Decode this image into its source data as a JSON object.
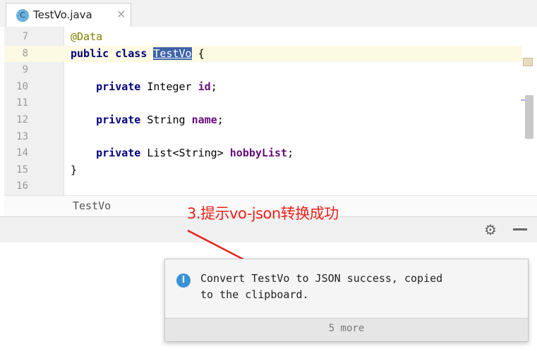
{
  "tab": {
    "icon_letter": "C",
    "label": "TestVo.java",
    "close": "×"
  },
  "editor": {
    "lines": [
      {
        "num": "7",
        "text": "@Data"
      },
      {
        "num": "8",
        "text": "public class TestVo {"
      },
      {
        "num": "9",
        "text": ""
      },
      {
        "num": "10",
        "text": "    private Integer id;"
      },
      {
        "num": "11",
        "text": ""
      },
      {
        "num": "12",
        "text": "    private String name;"
      },
      {
        "num": "13",
        "text": ""
      },
      {
        "num": "14",
        "text": "    private List<String> hobbyList;"
      },
      {
        "num": "15",
        "text": "}"
      },
      {
        "num": "16",
        "text": ""
      }
    ]
  },
  "breadcrumb": {
    "label": "TestVo"
  },
  "toolbar": {
    "gear_icon": "gear-icon",
    "minimize_icon": "minimize-icon"
  },
  "annotation": {
    "text": "3.提示vo-json转换成功",
    "color": "#e8221b"
  },
  "notification": {
    "icon": "info-icon",
    "line1": "Convert TestVo to JSON success, copied",
    "line2": "to the clipboard.",
    "footer": "5 more"
  }
}
